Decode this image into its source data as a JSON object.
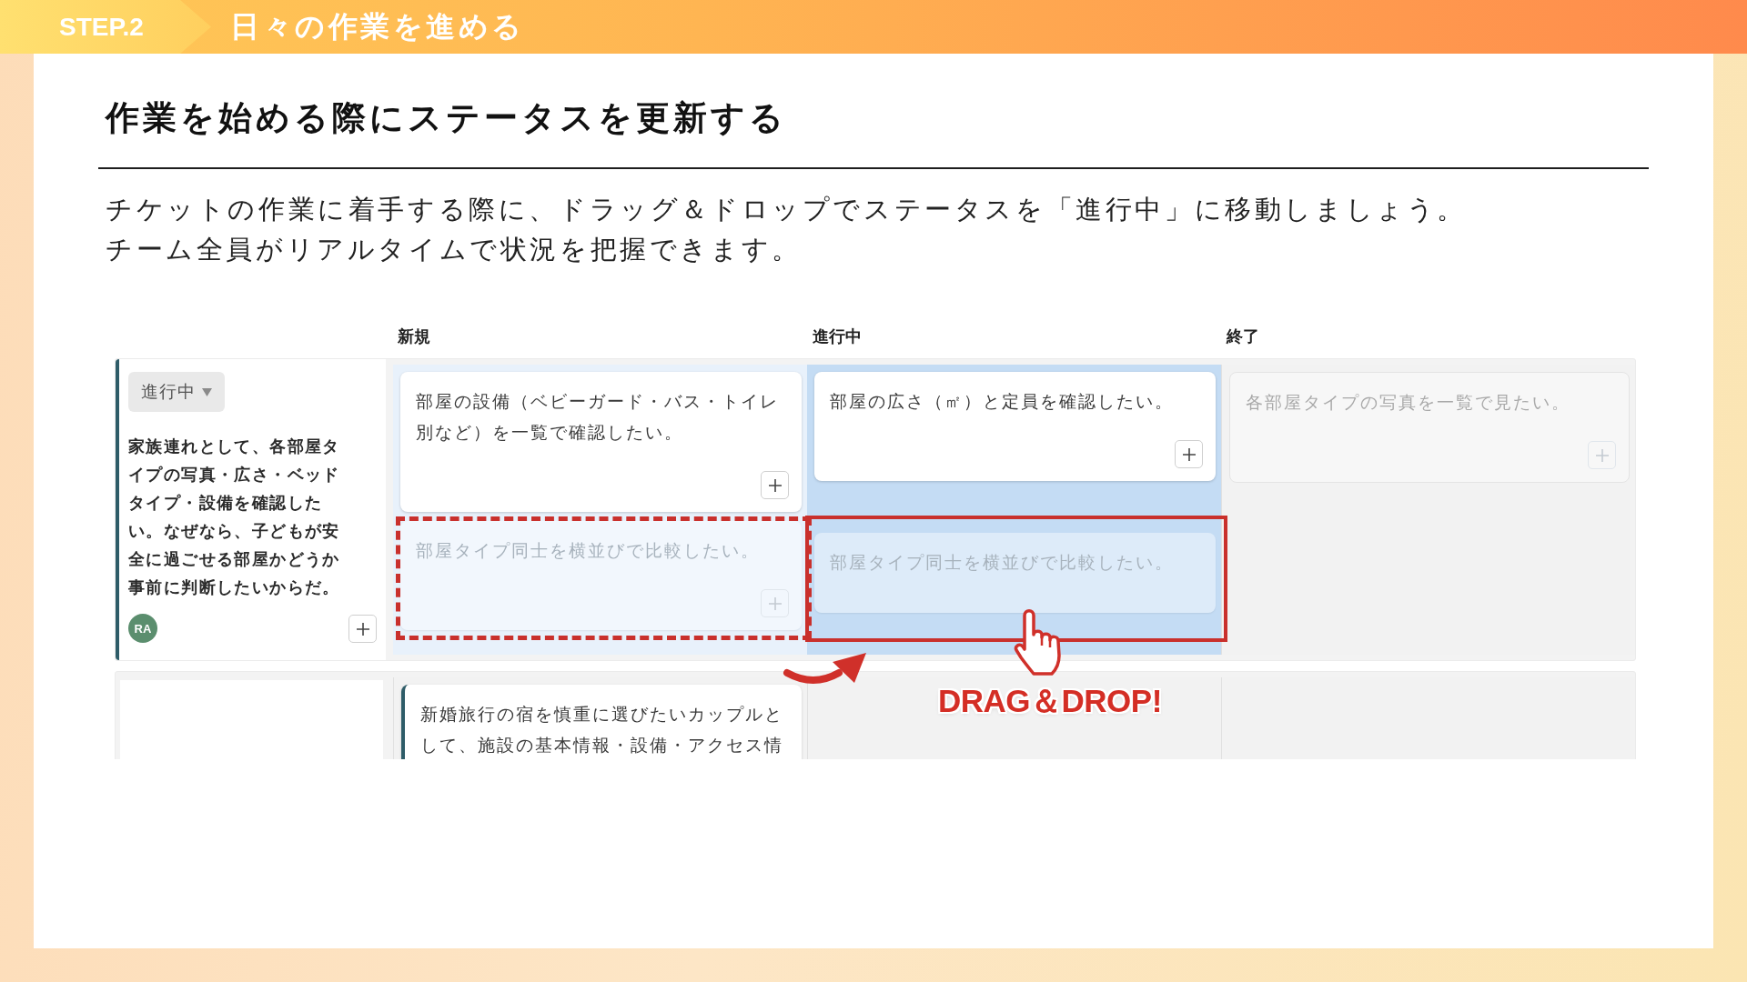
{
  "header": {
    "step": "STEP.2",
    "title": "日々の作業を進める"
  },
  "heading": "作業を始める際にステータスを更新する",
  "description": [
    "チケットの作業に着手する際に、ドラッグ＆ドロップでステータスを「進行中」に移動しましょう。",
    "チーム全員がリアルタイムで状況を把握できます。"
  ],
  "board": {
    "columns": [
      {
        "label": "新規"
      },
      {
        "label": "進行中"
      },
      {
        "label": "終了"
      }
    ],
    "rows": [
      {
        "story": {
          "status": "進行中",
          "text": "家族連れとして、各部屋タイプの写真・広さ・ベッドタイプ・設備を確認したい。なぜなら、子どもが安全に過ごせる部屋かどうか事前に判断したいからだ。",
          "avatar": "RA",
          "add_button": true
        },
        "cells": [
          {
            "drag_source": true,
            "drop_target": false,
            "cards": [
              {
                "kind": "normal",
                "outlined": false,
                "text": "部屋の設備（ベビーガード・バス・トイレ別など）を一覧で確認したい。",
                "add_button": true
              },
              {
                "kind": "ghost",
                "outlined": true,
                "text": "部屋タイプ同士を横並びで比較したい。",
                "add_button": true
              }
            ]
          },
          {
            "drag_source": false,
            "drop_target": true,
            "cards": [
              {
                "kind": "normal",
                "outlined": false,
                "text": "部屋の広さ（㎡）と定員を確認したい。",
                "add_button": true
              },
              {
                "kind": "ghost",
                "outlined": true,
                "text": "部屋タイプ同士を横並びで比較したい。",
                "add_button": false
              }
            ]
          },
          {
            "drag_source": false,
            "drop_target": false,
            "cards": [
              {
                "kind": "dimmed",
                "outlined": false,
                "text": "各部屋タイプの写真を一覧で見たい。",
                "add_button": true
              }
            ]
          }
        ]
      },
      {
        "cells": [
          {
            "drag_source": false,
            "drop_target": false,
            "cards": [
              {
                "kind": "story",
                "outlined": false,
                "text": "新婚旅行の宿を慎重に選びたいカップルとして、施設の基本情報・設備・アクセス情",
                "add_button": false
              }
            ]
          },
          {
            "drag_source": false,
            "drop_target": false
          },
          {
            "drag_source": false,
            "drop_target": false
          }
        ]
      }
    ],
    "annotation": {
      "label": "DRAG＆DROP!"
    }
  }
}
